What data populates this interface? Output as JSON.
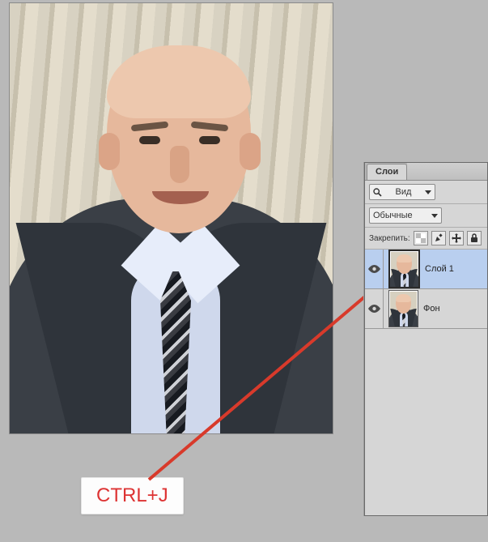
{
  "shortcut_label": "CTRL+J",
  "panel": {
    "tab_label": "Слои",
    "filter_label": "Вид",
    "blend_mode": "Обычные",
    "lock_label": "Закрепить:",
    "layers": [
      {
        "name": "Слой 1",
        "selected": true,
        "visible": true
      },
      {
        "name": "Фон",
        "selected": false,
        "visible": true
      }
    ]
  },
  "icons": {
    "search": "search-icon",
    "eye": "eye-icon",
    "checker": "transparency-lock-icon",
    "brush": "pixel-lock-icon",
    "move": "position-lock-icon",
    "lock": "all-lock-icon"
  }
}
